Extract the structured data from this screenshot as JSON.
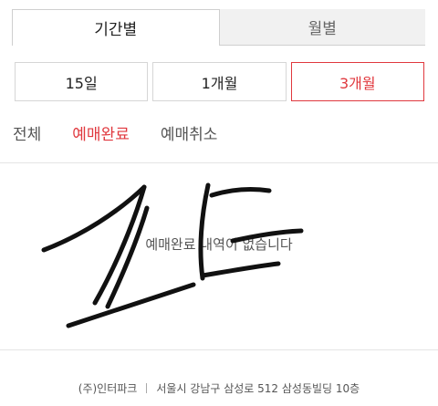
{
  "tabs": [
    {
      "label": "기간별",
      "active": true
    },
    {
      "label": "월별",
      "active": false
    }
  ],
  "periods": [
    {
      "label": "15일",
      "selected": false
    },
    {
      "label": "1개월",
      "selected": false
    },
    {
      "label": "3개월",
      "selected": true
    }
  ],
  "filters": [
    {
      "label": "전체",
      "active": false
    },
    {
      "label": "예매완료",
      "active": true
    },
    {
      "label": "예매취소",
      "active": false
    }
  ],
  "empty_message": "예매완료 내역이 없습니다",
  "footer": {
    "company": "(주)인터파크",
    "address": "서울시 강남구 삼성로 512 삼성동빌딩 10층"
  },
  "colors": {
    "accent": "#e0383e",
    "scribble": "#111111"
  }
}
